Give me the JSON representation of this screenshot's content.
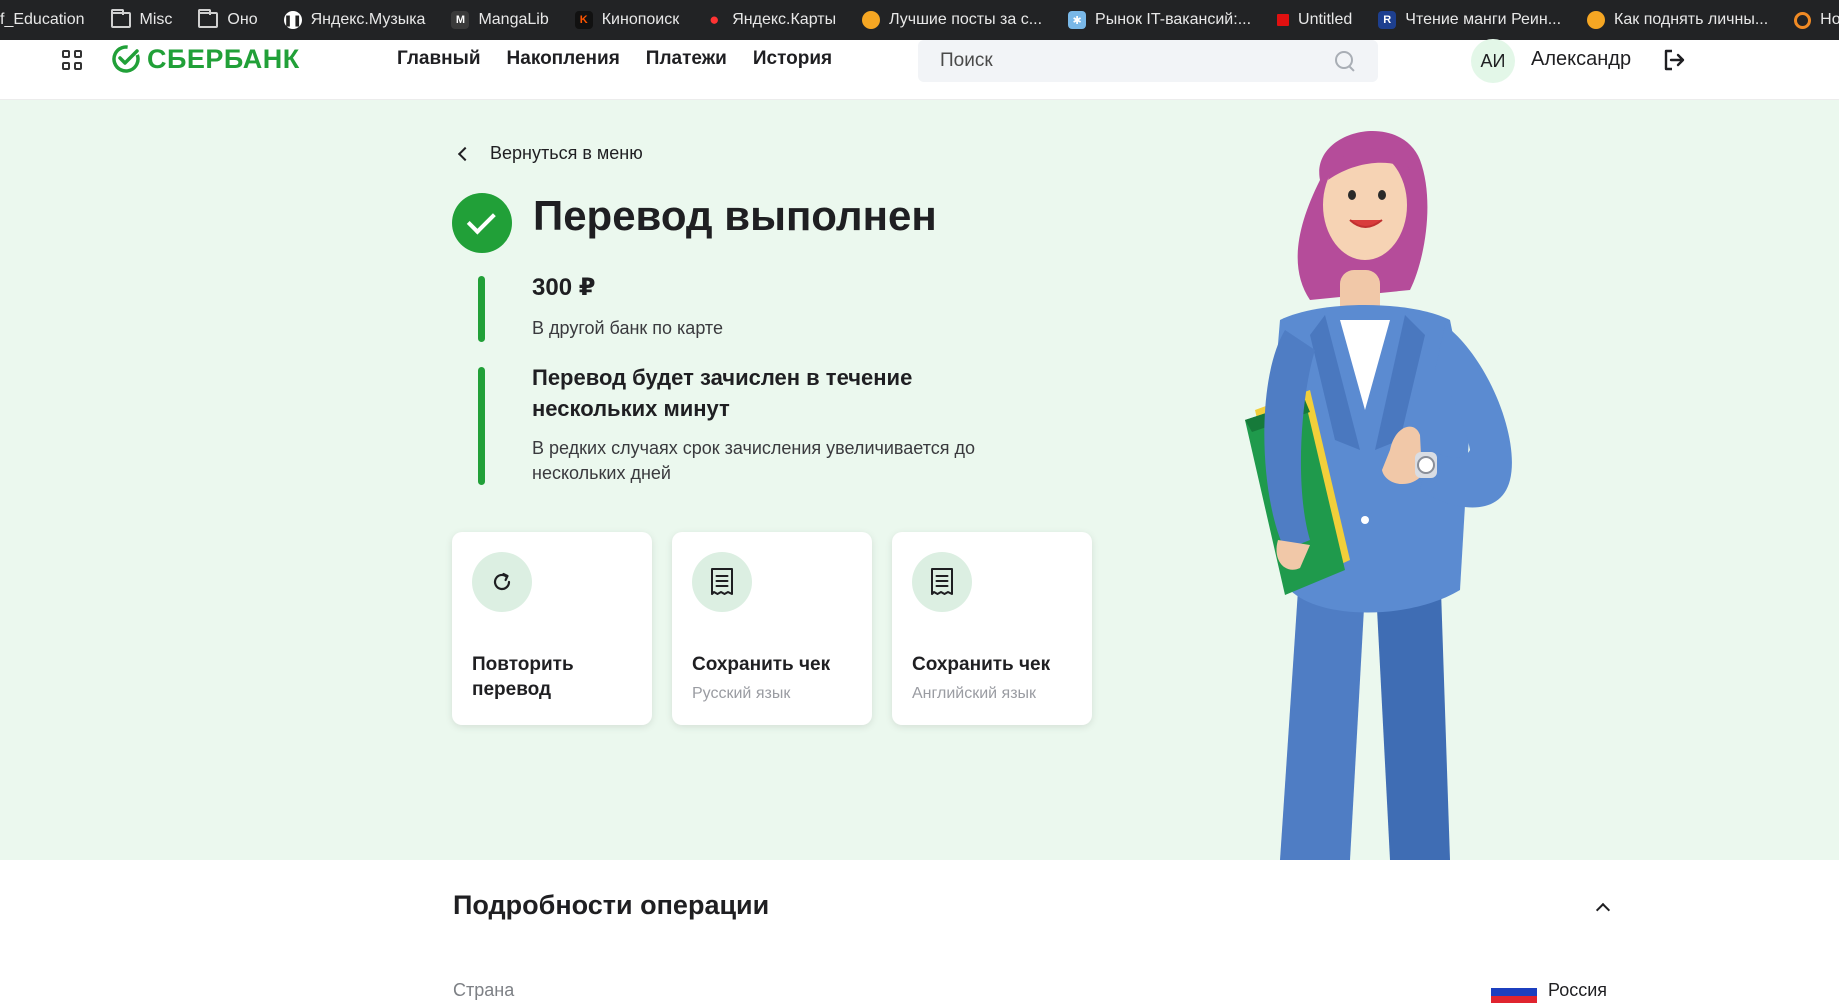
{
  "bookmarks": [
    {
      "label": "f_Education",
      "icon": "none"
    },
    {
      "label": "Misc",
      "icon": "folder-icon"
    },
    {
      "label": "Оно",
      "icon": "folder-icon"
    },
    {
      "label": "Яндекс.Музыка",
      "icon": "yandex-music-icon",
      "color": "#ffffff"
    },
    {
      "label": "MangaLib",
      "icon": "mangalib-icon",
      "color": "#333333"
    },
    {
      "label": "Кинопоиск",
      "icon": "kinopoisk-icon",
      "color": "#ff5500"
    },
    {
      "label": "Яндекс.Карты",
      "icon": "map-pin-icon",
      "color": "#ff3333"
    },
    {
      "label": "Лучшие посты за с...",
      "icon": "pikabu-icon",
      "color": "#f5a623"
    },
    {
      "label": "Рынок IT-вакансий:...",
      "icon": "habr-career-icon",
      "color": "#79b8e8"
    },
    {
      "label": "Untitled",
      "icon": "red-square-icon",
      "color": "#e01010"
    },
    {
      "label": "Чтение манги Реин...",
      "icon": "readmanga-icon",
      "color": "#1d3f8f"
    },
    {
      "label": "Как поднять личны...",
      "icon": "pikabu-icon",
      "color": "#f5a623"
    },
    {
      "label": "How To Guide: Set...",
      "icon": "ring-icon",
      "color": "#f08a24"
    }
  ],
  "header": {
    "logo_text": "СБЕРБАНК",
    "brand_color": "#21a038",
    "nav": [
      "Главный",
      "Накопления",
      "Платежи",
      "История"
    ],
    "search_placeholder": "Поиск",
    "avatar_initials": "АИ",
    "user_name": "Александр"
  },
  "hero": {
    "back_label": "Вернуться в меню",
    "title": "Перевод выполнен",
    "amount": "300 ₽",
    "amount_caption": "В другой банк по карте",
    "info_title": "Перевод будет зачислен в течение нескольких минут",
    "info_text": "В редких случаях срок зачисления увеличивается до нескольких дней",
    "cards": [
      {
        "label": "Повторить перевод",
        "sub": "",
        "icon": "repeat-icon"
      },
      {
        "label": "Сохранить чек",
        "sub": "Русский язык",
        "icon": "receipt-icon"
      },
      {
        "label": "Сохранить чек",
        "sub": "Английский язык",
        "icon": "receipt-icon"
      }
    ]
  },
  "details": {
    "title": "Подробности операции",
    "country_label": "Страна",
    "country_value": "Россия"
  }
}
